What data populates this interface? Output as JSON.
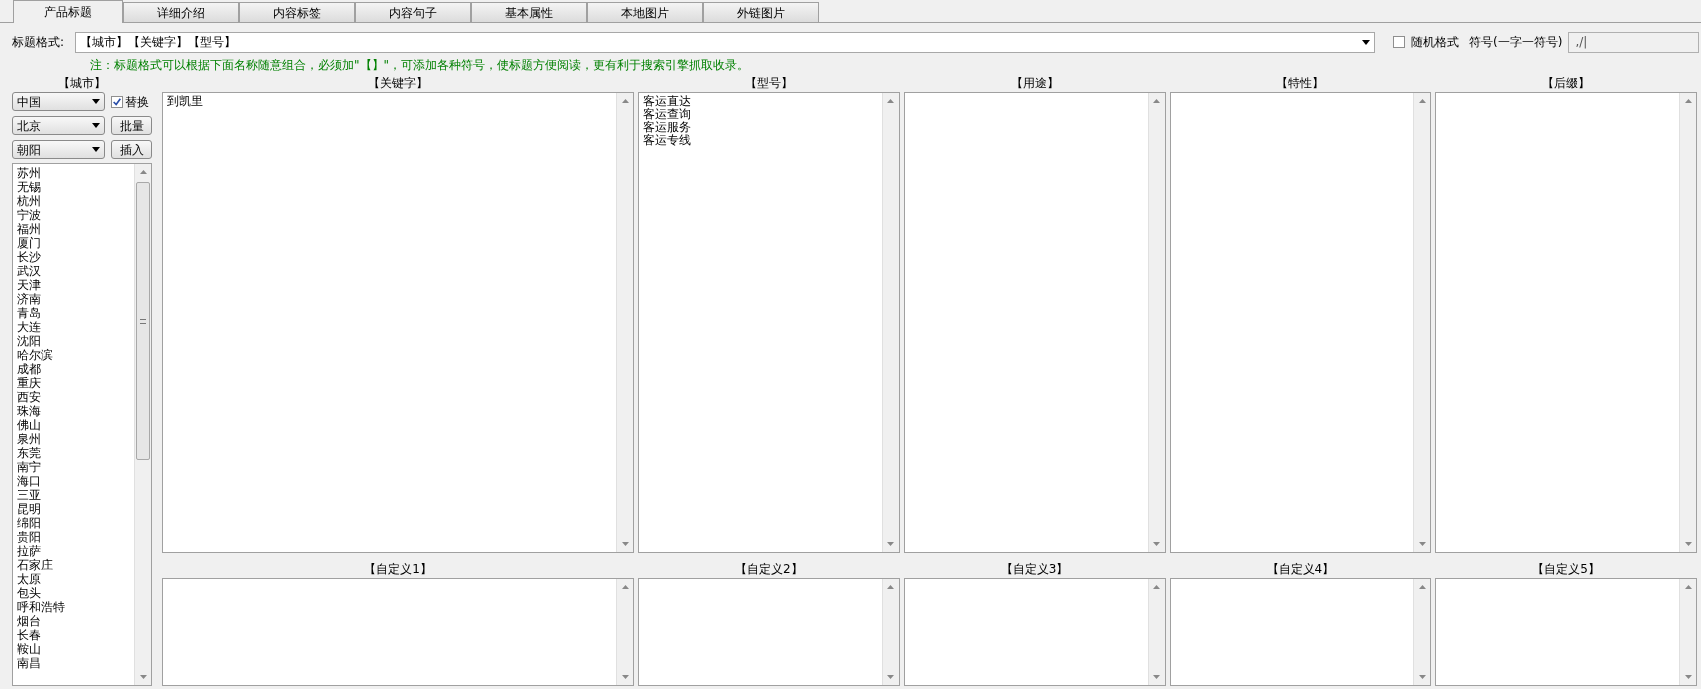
{
  "tabs": [
    {
      "label": "产品标题",
      "selected": true
    },
    {
      "label": "详细介绍",
      "selected": false
    },
    {
      "label": "内容标签",
      "selected": false
    },
    {
      "label": "内容句子",
      "selected": false
    },
    {
      "label": "基本属性",
      "selected": false
    },
    {
      "label": "本地图片",
      "selected": false
    },
    {
      "label": "外链图片",
      "selected": false
    }
  ],
  "title_format": {
    "label": "标题格式:",
    "value": "【城市】【关键字】【型号】"
  },
  "random_format": {
    "label": "随机格式",
    "checked": false
  },
  "symbol": {
    "label": "符号(一字一符号)",
    "value": ",/|"
  },
  "note": "注：标题格式可以根据下面名称随意组合，必须加\"【】\"，可添加各种符号，使标题方便阅读，更有利于搜索引擎抓取收录。",
  "city": {
    "header": "【城市】",
    "selects": [
      "中国",
      "北京",
      "朝阳"
    ],
    "replace": {
      "label": "替换",
      "checked": true
    },
    "buttons": [
      "批量",
      "插入"
    ],
    "items": [
      "苏州",
      "无锡",
      "杭州",
      "宁波",
      "福州",
      "厦门",
      "长沙",
      "武汉",
      "天津",
      "济南",
      "青岛",
      "大连",
      "沈阳",
      "哈尔滨",
      "成都",
      "重庆",
      "西安",
      "珠海",
      "佛山",
      "泉州",
      "东莞",
      "南宁",
      "海口",
      "三亚",
      "昆明",
      "绵阳",
      "贵阳",
      "拉萨",
      "石家庄",
      "太原",
      "包头",
      "呼和浩特",
      "烟台",
      "长春",
      "鞍山",
      "南昌"
    ]
  },
  "keyword_panel": {
    "header": "【关键字】",
    "lines": [
      "到凯里"
    ]
  },
  "top_panels": [
    {
      "header": "【型号】",
      "lines": [
        "客运直达",
        "客运查询",
        "客运服务",
        "客运专线"
      ]
    },
    {
      "header": "【用途】"
    },
    {
      "header": "【特性】"
    },
    {
      "header": "【后缀】"
    }
  ],
  "custom_panels": [
    {
      "header": "【自定义1】"
    },
    {
      "header": "【自定义2】"
    },
    {
      "header": "【自定义3】"
    },
    {
      "header": "【自定义4】"
    },
    {
      "header": "【自定义5】"
    }
  ]
}
